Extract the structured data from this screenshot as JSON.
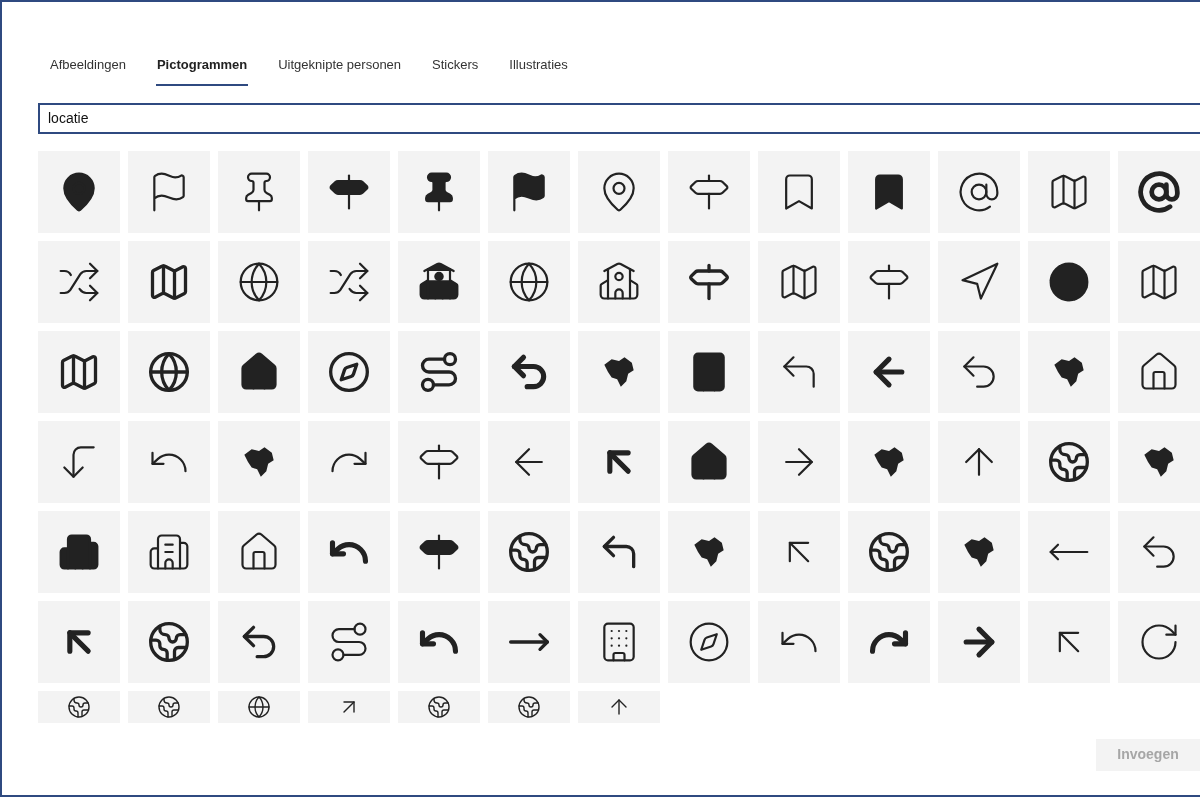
{
  "tabs": [
    {
      "label": "Afbeeldingen",
      "selected": false
    },
    {
      "label": "Pictogrammen",
      "selected": true
    },
    {
      "label": "Uitgeknipte personen",
      "selected": false
    },
    {
      "label": "Stickers",
      "selected": false
    },
    {
      "label": "Illustraties",
      "selected": false
    }
  ],
  "search": {
    "value": "locatie"
  },
  "insert_button": {
    "label": "Invoegen",
    "disabled": true
  }
}
